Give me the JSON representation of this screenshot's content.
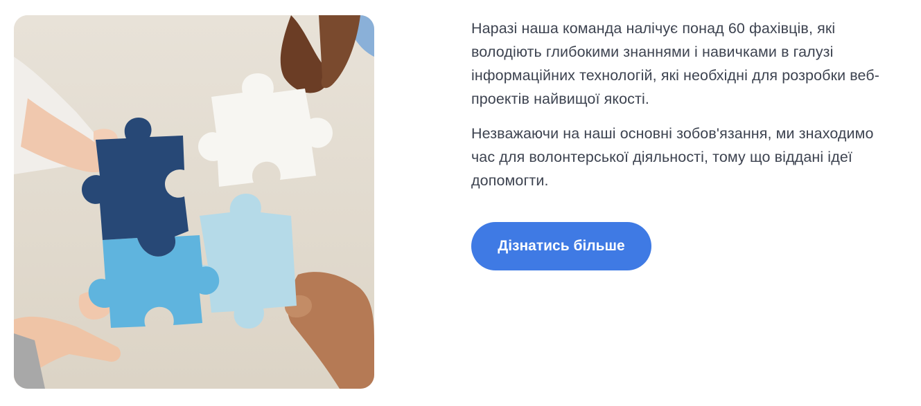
{
  "about": {
    "image": {
      "subject": "hands-connecting-puzzle-pieces",
      "colors": {
        "background": "#e4ddd2",
        "piece_navy": "#274876",
        "piece_white": "#f7f6f2",
        "piece_blue": "#5cb3df",
        "piece_light": "#b3d9e7"
      }
    },
    "paragraphs": [
      "Наразі наша команда налічує понад 60 фахівців, які володіють глибокими знаннями і навичками в галузі інформаційних технологій, які необхідні для розробки веб-проектів найвищої якості.",
      "Незважаючи на наші основні зобов'язання, ми знаходимо час для волонтерської діяльності, тому що віддані ідеї допомогти."
    ],
    "button": {
      "label": "Дізнатись більше",
      "color": "#3f7ae4"
    }
  }
}
